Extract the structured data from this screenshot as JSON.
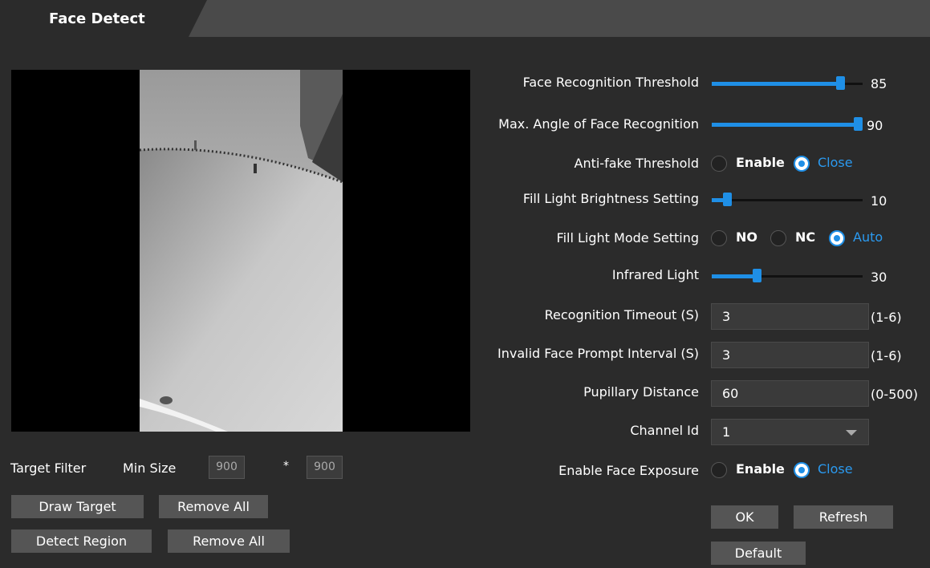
{
  "tab": {
    "label": "Face Detect"
  },
  "target_filter": {
    "label": "Target Filter",
    "min_size_label": "Min Size",
    "width": "900",
    "separator": "*",
    "height": "900"
  },
  "buttons": {
    "draw_target": "Draw Target",
    "remove_all_1": "Remove All",
    "detect_region": "Detect Region",
    "remove_all_2": "Remove All",
    "ok": "OK",
    "refresh": "Refresh",
    "default": "Default"
  },
  "settings": {
    "face_recognition_threshold": {
      "label": "Face Recognition Threshold",
      "value": "85",
      "fraction": 0.85
    },
    "max_angle": {
      "label": "Max. Angle of Face Recognition",
      "value": "90",
      "fraction": 1.0
    },
    "anti_fake": {
      "label": "Anti-fake Threshold",
      "options": [
        "Enable",
        "Close"
      ],
      "selected": "Close"
    },
    "fill_light_brightness": {
      "label": "Fill Light Brightness Setting",
      "value": "10",
      "fraction": 0.1
    },
    "fill_light_mode": {
      "label": "Fill Light Mode Setting",
      "options": [
        "NO",
        "NC",
        "Auto"
      ],
      "selected": "Auto"
    },
    "infrared_light": {
      "label": "Infrared Light",
      "value": "30",
      "fraction": 0.3
    },
    "recognition_timeout": {
      "label": "Recognition Timeout (S)",
      "value": "3",
      "range": "(1-6)"
    },
    "invalid_face_prompt": {
      "label": "Invalid Face Prompt Interval (S)",
      "value": "3",
      "range": "(1-6)"
    },
    "pupillary_distance": {
      "label": "Pupillary Distance",
      "value": "60",
      "range": "(0-500)"
    },
    "channel_id": {
      "label": "Channel Id",
      "value": "1"
    },
    "face_exposure": {
      "label": "Enable Face Exposure",
      "options": [
        "Enable",
        "Close"
      ],
      "selected": "Close"
    }
  },
  "colors": {
    "accent": "#1f8fe6",
    "background": "#2b2b2b",
    "header": "#4a4a4a"
  },
  "icons": {
    "dropdown": "chevron-down-icon"
  }
}
